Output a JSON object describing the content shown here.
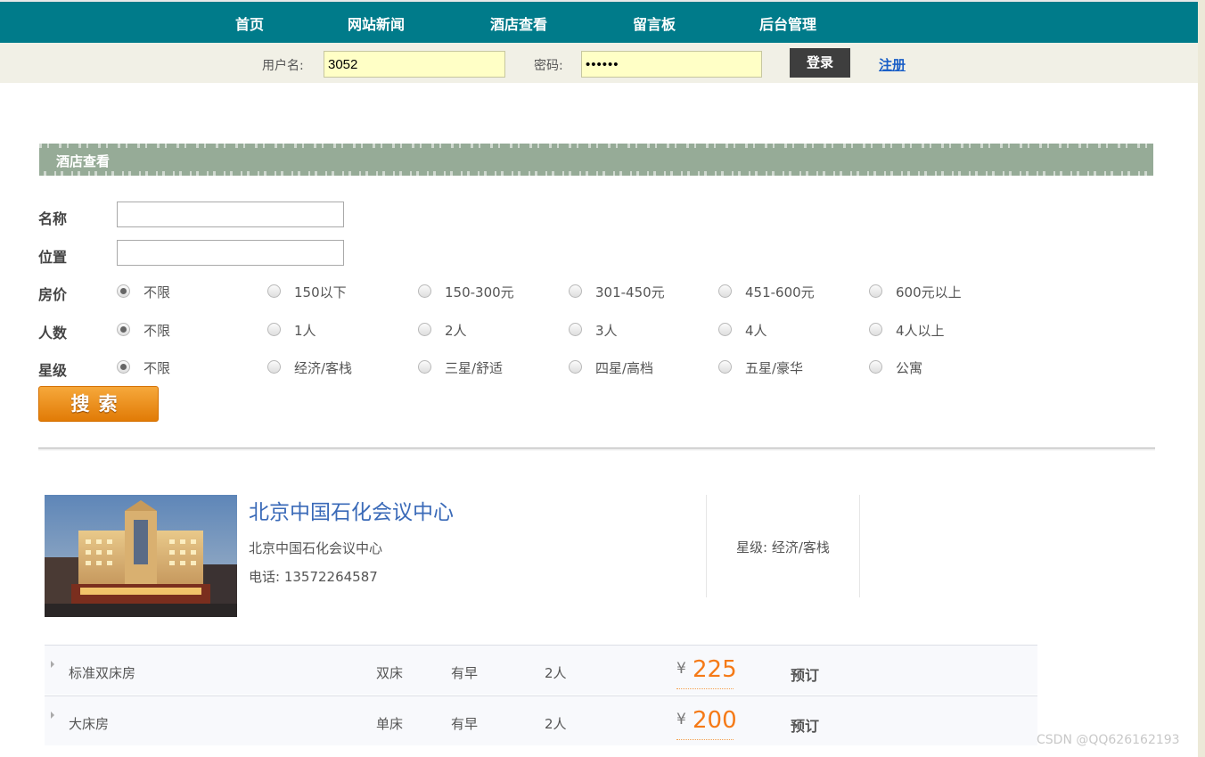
{
  "nav": {
    "items": [
      "首页",
      "网站新闻",
      "酒店查看",
      "留言板",
      "后台管理"
    ]
  },
  "login": {
    "username_label": "用户名:",
    "username_value": "3052",
    "password_label": "密码:",
    "password_value": "••••••",
    "login_button": "登录",
    "register_link": "注册"
  },
  "section": {
    "title": "酒店查看"
  },
  "search_form": {
    "name_label": "名称",
    "location_label": "位置",
    "price_label": "房价",
    "price_options": [
      "不限",
      "150以下",
      "150-300元",
      "301-450元",
      "451-600元",
      "600元以上"
    ],
    "people_label": "人数",
    "people_options": [
      "不限",
      "1人",
      "2人",
      "3人",
      "4人",
      "4人以上"
    ],
    "star_label": "星级",
    "star_options": [
      "不限",
      "经济/客栈",
      "三星/舒适",
      "四星/高档",
      "五星/豪华",
      "公寓"
    ],
    "search_button": "搜索"
  },
  "hotel": {
    "name": "北京中国石化会议中心",
    "address": "北京中国石化会议中心",
    "phone": "电话: 13572264587",
    "star": "星级: 经济/客栈",
    "rooms": [
      {
        "name": "标准双床房",
        "bed": "双床",
        "breakfast": "有早",
        "people": "2人",
        "currency": "¥",
        "price": "225",
        "book": "预订"
      },
      {
        "name": "大床房",
        "bed": "单床",
        "breakfast": "有早",
        "people": "2人",
        "currency": "¥",
        "price": "200",
        "book": "预订"
      }
    ]
  },
  "watermark": "CSDN @QQ626162193",
  "colors": {
    "nav_bg": "#007b8a",
    "section_bg": "#96ab97",
    "price": "#f57a17",
    "hotel_name": "#3a6ab8",
    "search_button": "#e8890f"
  }
}
